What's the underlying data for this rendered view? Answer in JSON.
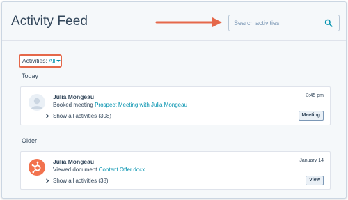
{
  "header": {
    "title": "Activity Feed",
    "search": {
      "placeholder": "Search activities",
      "value": ""
    }
  },
  "filter": {
    "label": "Activities:",
    "value": "All"
  },
  "sections": {
    "today": "Today",
    "older": "Older"
  },
  "activities": [
    {
      "person": "Julia Mongeau",
      "action": "Booked meeting",
      "link": "Prospect Meeting with Julia Mongeau",
      "time": "3:45 pm",
      "show_all": "Show all activities (308)",
      "tag": "Meeting"
    },
    {
      "person": "Julia Mongeau",
      "action": "Viewed document",
      "link": "Content Offer.docx",
      "time": "January 14",
      "show_all": "Show all activities (38)",
      "tag": "View"
    }
  ],
  "colors": {
    "accent": "#0091ae",
    "highlight": "#e5684a",
    "text": "#33475b",
    "hubspot": "#f2724e"
  },
  "icons": [
    "arrow-right-icon",
    "search-icon",
    "caret-down-icon",
    "default-avatar-icon",
    "hubspot-logo-icon",
    "chevron-right-icon"
  ]
}
